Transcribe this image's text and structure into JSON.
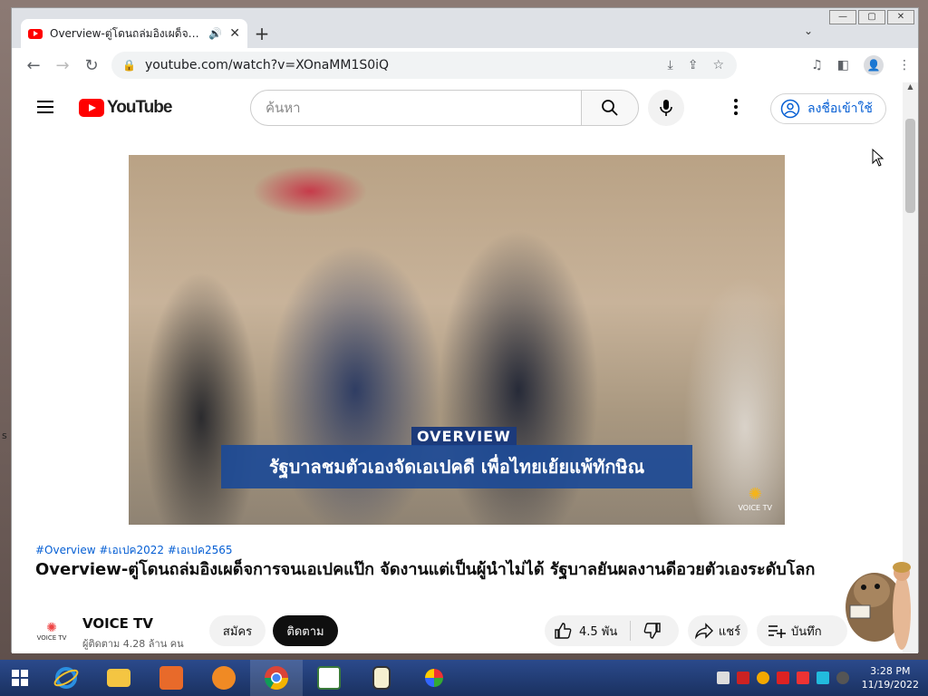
{
  "browser": {
    "tab_title": "Overview-ตู่โดนถล่มอิงเผด็จการ",
    "url": "youtube.com/watch?v=XOnaMM1S0iQ"
  },
  "youtube": {
    "logo_text": "YouTube",
    "search_placeholder": "ค้นหา",
    "signin_label": "ลงชื่อเข้าใช้"
  },
  "video": {
    "overlay_tag": "OVERVIEW",
    "overlay_caption": "รัฐบาลชมตัวเองจัดเอเปคดี เพื่อไทยเย้ยแพ้ทักษิณ",
    "watermark": "VOICE TV",
    "hashtags": "#Overview #เอเปค2022 #เอเปค2565",
    "title": "Overview-ตู่โดนถล่มอิงเผด็จการจนเอเปคแป๊ก จัดงานแต่เป็นผู้นำไม่ได้ รัฐบาลยันผลงานดีอวยตัวเองระดับโลก"
  },
  "channel": {
    "name": "VOICE TV",
    "subscribers": "ผู้ติดตาม 4.28 ล้าน คน",
    "avatar_text": "VOICE TV",
    "join_label": "สมัคร",
    "subscribe_label": "ติดตาม"
  },
  "actions": {
    "likes": "4.5 พัน",
    "share_label": "แชร์",
    "save_label": "บันทึก"
  },
  "desktop": {
    "edge_text": "s"
  },
  "taskbar": {
    "time": "3:28 PM",
    "date": "11/19/2022"
  }
}
